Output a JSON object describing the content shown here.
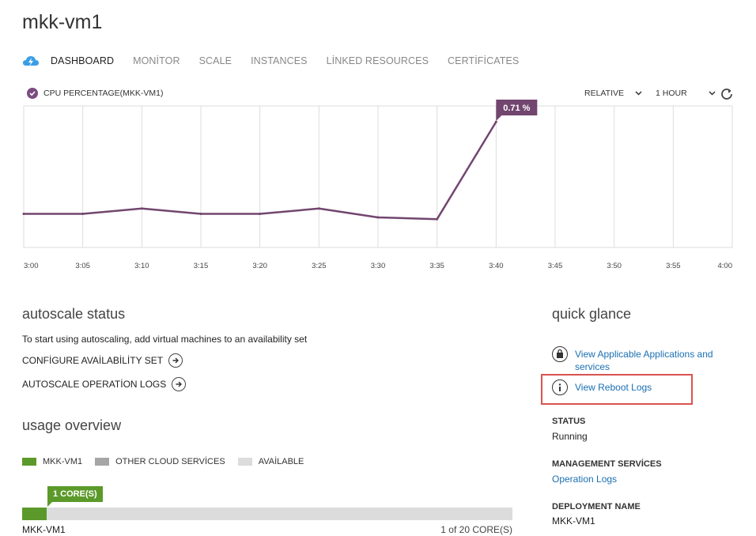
{
  "page": {
    "title": "mkk-vm1"
  },
  "nav": {
    "tabs": [
      "DASHBOARD",
      "MONİTOR",
      "SCALE",
      "INSTANCES",
      "LİNKED RESOURCES",
      "CERTİFİCATES"
    ],
    "active_index": 0
  },
  "chart": {
    "metric_label": "CPU PERCENTAGE(MKK-VM1)",
    "relative_label": "RELATIVE",
    "range_label": "1 HOUR",
    "callout": "0.71 %",
    "series_color": "#72466f"
  },
  "chart_data": {
    "type": "line",
    "x": [
      "3:00",
      "3:05",
      "3:10",
      "3:15",
      "3:20",
      "3:25",
      "3:30",
      "3:35",
      "3:40",
      "3:45",
      "3:50",
      "3:55",
      "4:00"
    ],
    "series": [
      {
        "values": [
          0.19,
          0.19,
          0.22,
          0.19,
          0.19,
          0.22,
          0.17,
          0.16,
          0.71,
          null,
          null,
          null,
          null
        ]
      }
    ],
    "ylim": [
      0,
      0.8
    ],
    "grid": true,
    "annotations": [
      "0.71 %"
    ]
  },
  "autoscale": {
    "title": "autoscale status",
    "description": "To start using autoscaling, add virtual machines to an availability set",
    "configure_label": "CONFİGURE AVAİLABİLİTY SET",
    "logs_label": "AUTOSCALE OPERATİON LOGS"
  },
  "usage": {
    "title": "usage overview",
    "legend": [
      {
        "label": "MKK-VM1",
        "color": "#5b9a2a"
      },
      {
        "label": "OTHER CLOUD SERVİCES",
        "color": "#a6a6a6"
      },
      {
        "label": "AVAİLABLE",
        "color": "#dcdcdc"
      }
    ],
    "bar_label": "1 CORE(S)",
    "used": 1,
    "total": 20,
    "name": "MKK-VM1",
    "used_text": "1",
    "total_text": " of 20 CORE(S)"
  },
  "quick_glance": {
    "title": "quick glance",
    "apps_link": "View Applicable Applications and services",
    "reboot_link": "View Reboot Logs",
    "highlight_color": "#d9534f",
    "status_label": "STATUS",
    "status_value": "Running",
    "mgmt_label": "MANAGEMENT SERVİCES",
    "mgmt_link": "Operation Logs",
    "deploy_label": "DEPLOYMENT NAME",
    "deploy_value": "MKK-VM1"
  }
}
